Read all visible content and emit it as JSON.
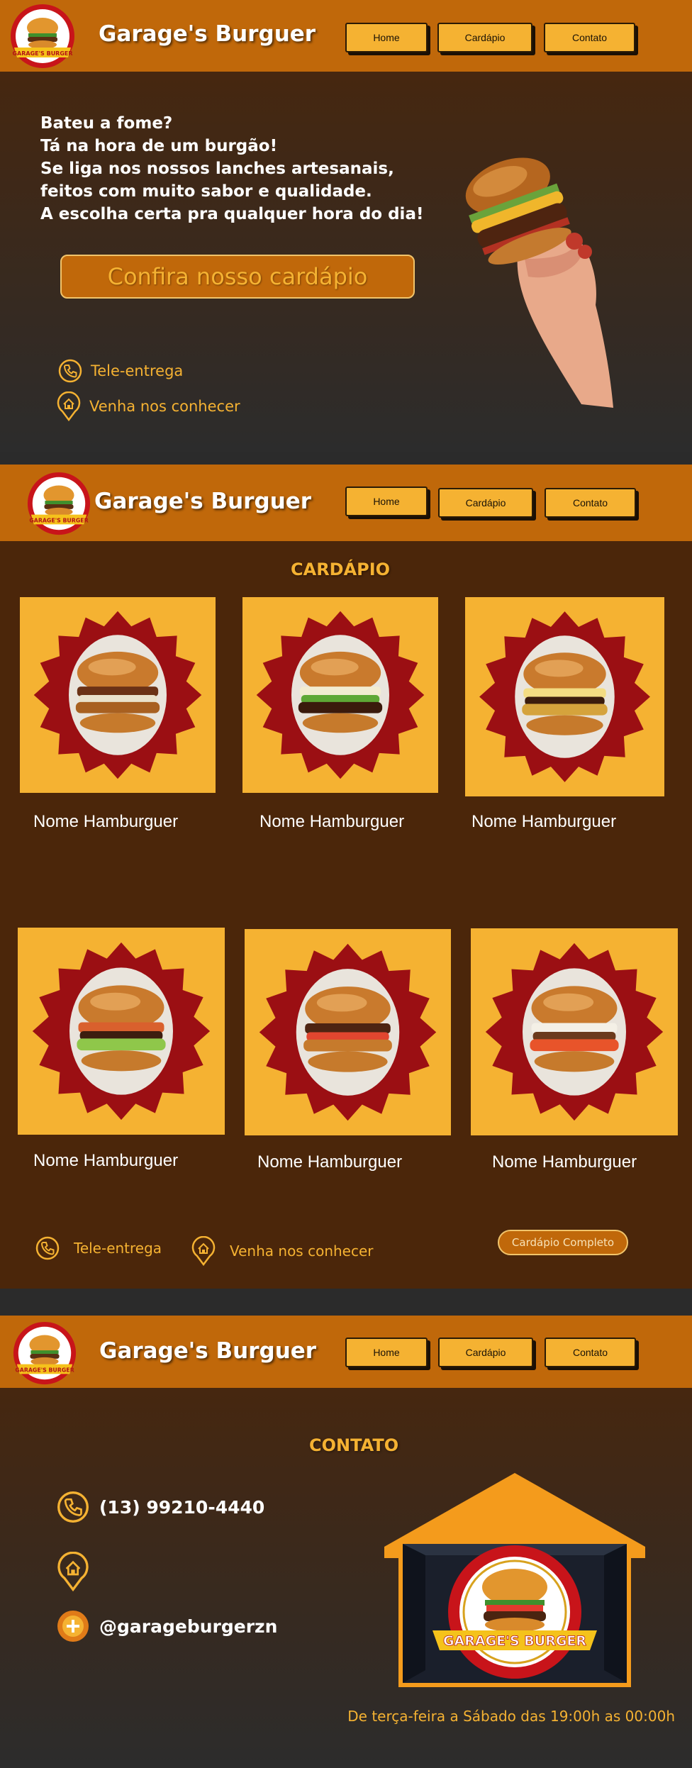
{
  "brand": {
    "name": "Garage's Burguer",
    "logo_text": "GARAGE'S BURGER"
  },
  "nav": {
    "home": "Home",
    "menu": "Cardápio",
    "contact": "Contato"
  },
  "hero": {
    "text": "Bateu a fome?\nTá na hora de um burgão!\n Se liga nos nossos lanches artesanais, feitos com muito sabor e qualidade.\n A escolha certa pra qualquer hora do dia!",
    "cta": "Confira nosso cardápio"
  },
  "links": {
    "delivery": "Tele-entrega",
    "visit": "Venha nos conhecer"
  },
  "menu_section": {
    "title": "CARDÁPIO",
    "items": [
      {
        "name": "Nome Hamburguer"
      },
      {
        "name": "Nome Hamburguer"
      },
      {
        "name": "Nome Hamburguer"
      },
      {
        "name": "Nome Hamburguer"
      },
      {
        "name": "Nome Hamburguer"
      },
      {
        "name": "Nome Hamburguer"
      }
    ],
    "full_menu": "Cardápio Completo"
  },
  "contact_section": {
    "title": "CONTATO",
    "phone": "(13) 99210-4440",
    "instagram": "@garageburgerzn",
    "hours": "De terça-feira a Sábado das 19:00h as 00:00h"
  },
  "colors": {
    "header": "#c0680a",
    "accent": "#f5b232",
    "brown": "#4b260a",
    "seal": "#9b0f13"
  },
  "icons": [
    "phone-icon",
    "location-home-icon",
    "instagram-plus-icon"
  ]
}
